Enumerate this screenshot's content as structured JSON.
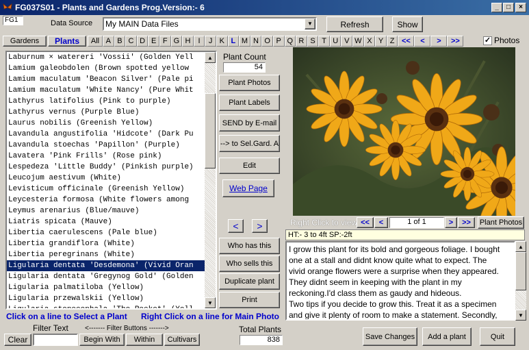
{
  "window": {
    "title": "FG037S01 - Plants and Gardens   Prog.Version:-  6"
  },
  "topbar": {
    "fg_tag": "FG1",
    "data_source_label": "Data Source",
    "data_source_value": "My MAIN Data Files",
    "refresh_label": "Refresh",
    "show_label": "Show"
  },
  "tabs": {
    "gardens_label": "Gardens",
    "plants_label": "Plants"
  },
  "letters": [
    "All",
    "A",
    "B",
    "C",
    "D",
    "E",
    "F",
    "G",
    "H",
    "I",
    "J",
    "K",
    "L",
    "M",
    "N",
    "O",
    "P",
    "Q",
    "R",
    "S",
    "T",
    "U",
    "V",
    "W",
    "X",
    "Y",
    "Z"
  ],
  "nav_buttons": [
    "<<",
    "<",
    ">",
    ">>"
  ],
  "photos_checkbox": {
    "label": "Photos",
    "checked": true
  },
  "plant_list": [
    "Laburnum × watereri 'Vossii' (Golden Yell",
    "Lamium galeobdolen (Brown spotted yellow",
    "Lamium maculatum 'Beacon Silver' (Pale pi",
    "Lamium maculatum 'White Nancy' (Pure Whit",
    "Lathyrus latifolius (Pink to purple)",
    "Lathyrus vernus (Purple Blue)",
    "Laurus nobilis (Greenish Yellow)",
    "Lavandula angustifolia 'Hidcote' (Dark Pu",
    "Lavandula stoechas 'Papillon' (Purple)",
    "Lavatera 'Pink Frills' (Rose pink)",
    "Lespedeza 'Little Buddy' (Pinkish purple)",
    "Leucojum aestivum (White)",
    "Levisticum officinale (Greenish Yellow)",
    "Leycesteria formosa (White flowers among",
    "Leymus arenarius (Blue/mauve)",
    "Liatris spicata (Mauve)",
    "Libertia caerulescens (Pale blue)",
    "Libertia grandiflora (White)",
    "Libertia peregrinans (White)",
    "Ligularia dentata 'Desdemona' (Vivid Oran",
    "Ligularia dentata 'Gregynog Gold' (Golden",
    "Ligularia palmatiloba (Yellow)",
    "Ligularia przewalskii (Yellow)",
    "Ligularia stenocephala 'The Rocket' (Yell"
  ],
  "selected_index": 19,
  "middle": {
    "plant_count_label": "Plant Count",
    "plant_count_value": "54",
    "buttons": [
      "Plant Photos",
      "Plant Labels",
      "SEND by E-mail",
      "--> to Sel.Gard. A",
      "Edit"
    ],
    "web_page_label": "Web Page",
    "prev_label": "<",
    "next_label": ">",
    "buttons2": [
      "Who has this",
      "Who sells this",
      "Duplicate plant",
      "Print"
    ]
  },
  "photo_nav": {
    "hint": "Right Click to view",
    "first": "<<",
    "prev": "<",
    "page": "1  of  1",
    "next": ">",
    "last": ">>",
    "photos_label": "Plant Photos"
  },
  "info": {
    "size_line": "HT:- 3 to 4ft   SP:-2ft"
  },
  "description": "I grow this plant for its bold and gorgeous foliage. I bought one at a stall and didnt know quite what to expect. The vivid orange flowers were a surprise when they appeared. They didnt seem in keeping with the plant in my reckoning.I'd class them as gaudy and hideous.\nTwo tips if you decide to grow this. Treat it as a specimen and give it plenty of room to make a statement. Secondly, take whatever action you prefer to protect it from slugs and",
  "hints": {
    "left": "Click on a line to Select a Plant",
    "right": "Right Click on a line for Main Photo"
  },
  "bottom": {
    "filter_text_label": "Filter Text",
    "filter_buttons_label": "<------- Filter Buttons ------->",
    "clear_label": "Clear",
    "begin_with_label": "Begin With",
    "within_label": "Within",
    "cultivars_label": "Cultivars",
    "total_plants_label": "Total Plants",
    "total_plants_value": "838",
    "save_label": "Save Changes",
    "add_label": "Add a plant",
    "quit_label": "Quit"
  },
  "colors": {
    "title_bar": "#0a246a",
    "selection": "#0a246a",
    "link": "#0000cc",
    "flower": "#f0a818"
  }
}
